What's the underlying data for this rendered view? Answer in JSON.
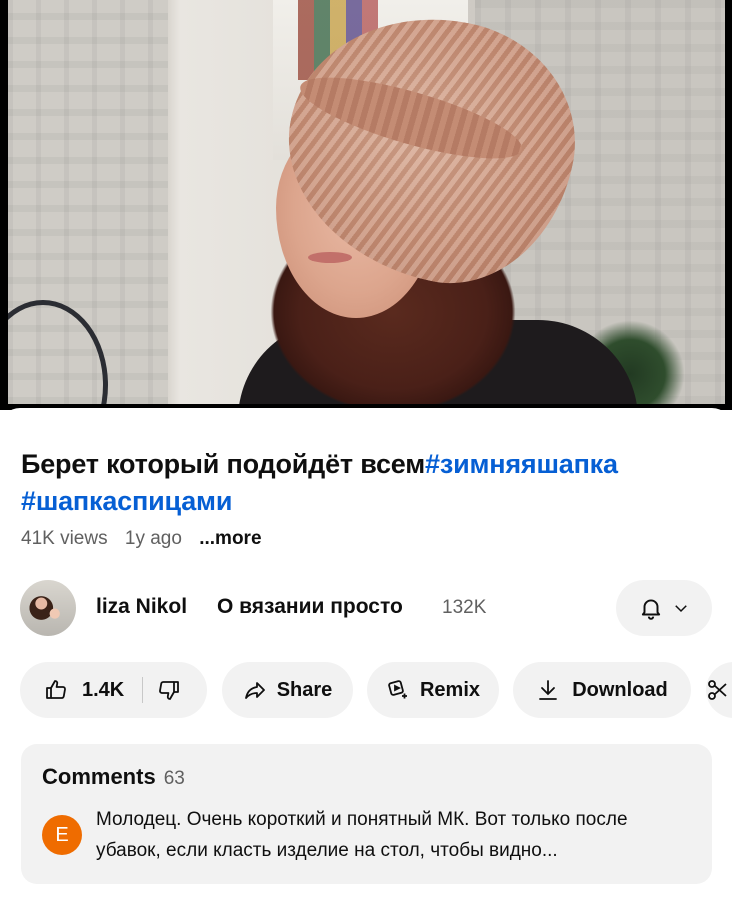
{
  "video": {
    "title_main": "Берет который подойдёт всем",
    "title_tags": "#зимняяшапка #шапкаспицами"
  },
  "meta": {
    "views": "41K views",
    "age": "1y ago",
    "more": "...more"
  },
  "channel": {
    "name": "liza Nikol",
    "subtitle": "О вязании просто",
    "subscribers": "132K"
  },
  "actions": {
    "like_count": "1.4K",
    "share_label": "Share",
    "remix_label": "Remix",
    "download_label": "Download"
  },
  "comments": {
    "label": "Comments",
    "count": "63",
    "top_comment": {
      "avatar_letter": "E",
      "avatar_color": "#ef6c00",
      "text": "Молодец.  Очень короткий и понятный МК. Вот только после убавок, если класть изделие на стол, чтобы видно..."
    }
  },
  "colors": {
    "hashtag": "#065fd4",
    "pill_bg": "#f2f2f2",
    "secondary_text": "#606060"
  }
}
